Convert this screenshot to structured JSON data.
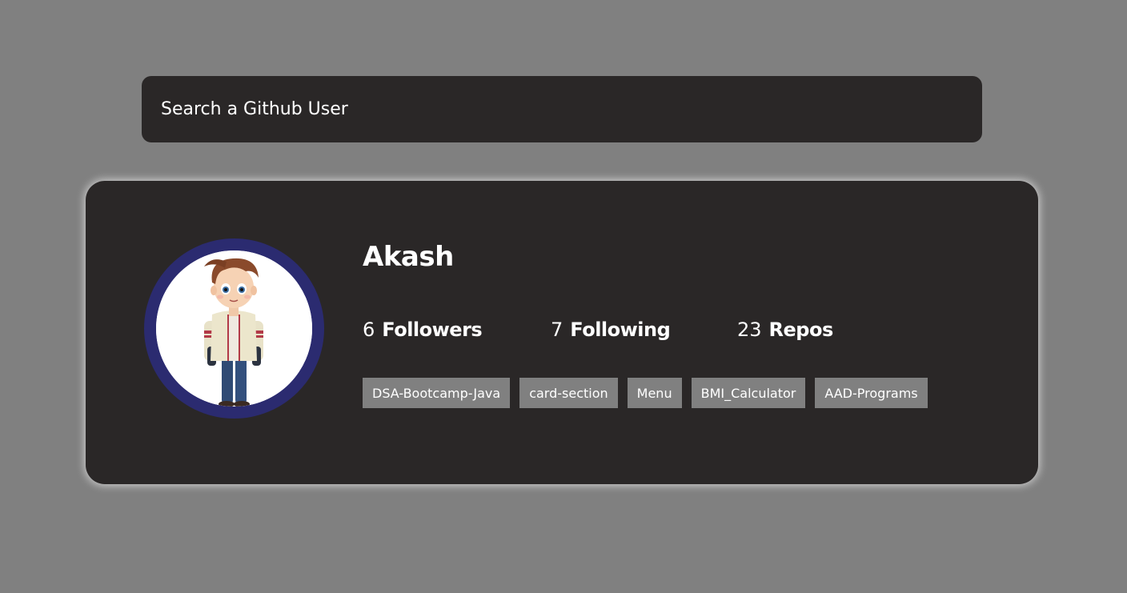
{
  "search": {
    "placeholder": "Search a Github User",
    "value": ""
  },
  "profile": {
    "name": "Akash",
    "avatar_icon": "avatar-image",
    "stats": [
      {
        "value": "6",
        "label": "Followers"
      },
      {
        "value": "7",
        "label": "Following"
      },
      {
        "value": "23",
        "label": "Repos"
      }
    ],
    "repos": [
      "DSA-Bootcamp-Java",
      "card-section",
      "Menu",
      "BMI_Calculator",
      "AAD-Programs"
    ]
  },
  "colors": {
    "background": "#808080",
    "card": "#2a2727",
    "avatar_ring": "#2b2b70",
    "repo_tag": "#808080",
    "text": "#ffffff"
  }
}
